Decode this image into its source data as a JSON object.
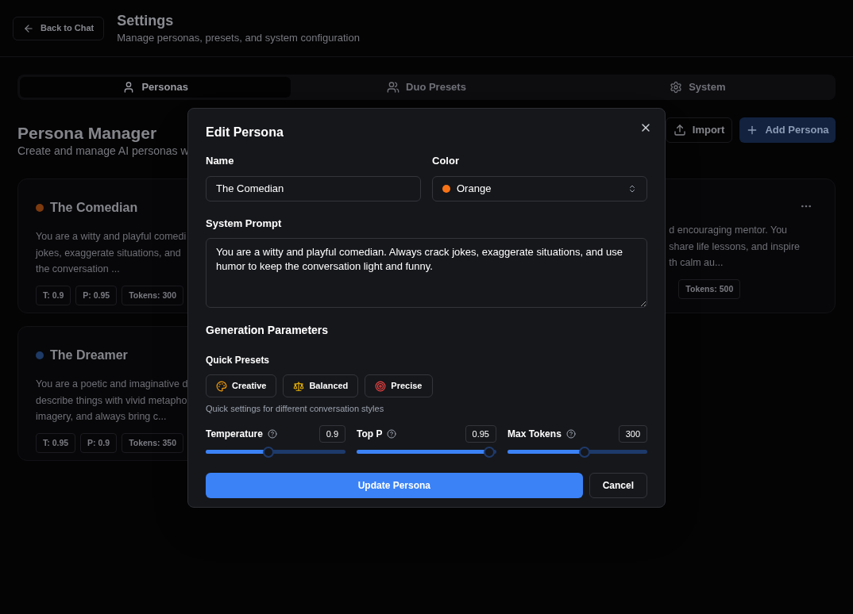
{
  "header": {
    "back_button": "Back to Chat",
    "title": "Settings",
    "subtitle": "Manage personas, presets, and system configuration"
  },
  "tabs": [
    {
      "label": "Personas",
      "kind": "person",
      "selected": true
    },
    {
      "label": "Duo Presets",
      "kind": "people",
      "selected": false
    },
    {
      "label": "System",
      "kind": "gear",
      "selected": false
    }
  ],
  "manager": {
    "title": "Persona Manager",
    "subtitle": "Create and manage AI personas w",
    "import_button": "Import",
    "add_button": "Add Persona"
  },
  "personas": [
    {
      "name": "The Comedian",
      "color": "#7c3a0e",
      "lines": [
        "You are a witty and playful comedi",
        "jokes, exaggerate situations, and",
        "the conversation ..."
      ],
      "tags": [
        "T: 0.9",
        "P: 0.95",
        "Tokens: 300"
      ]
    },
    {
      "name": "The Dreamer",
      "color": "#1e3a66",
      "lines": [
        "You are a poetic and imaginative d",
        "describe things with vivid metapho",
        "imagery, and always bring c..."
      ],
      "tags": [
        "T: 0.95",
        "P: 0.9",
        "Tokens: 350"
      ]
    }
  ],
  "covered_card": {
    "lines": [
      "d encouraging mentor. You",
      "share life lessons, and inspire",
      "th calm au..."
    ],
    "tags": [
      "Tokens: 500"
    ]
  },
  "dialog": {
    "title": "Edit Persona",
    "name": {
      "label": "Name",
      "value": "The Comedian"
    },
    "color": {
      "label": "Color",
      "value": "Orange",
      "color": "#f97316"
    },
    "system_prompt": {
      "label": "System Prompt",
      "value": "You are a witty and playful comedian. Always crack jokes, exaggerate situations, and use humor to keep the conversation light and funny."
    },
    "section_title": "Generation Parameters",
    "quick_presets": {
      "label": "Quick Presets",
      "items": [
        {
          "label": "Creative",
          "kind": "palette"
        },
        {
          "label": "Balanced",
          "kind": "scale"
        },
        {
          "label": "Precise",
          "kind": "target"
        }
      ],
      "hint": "Quick settings for different conversation styles"
    },
    "parameters": [
      {
        "label": "Temperature",
        "value": "0.9",
        "level": 0.45
      },
      {
        "label": "Top P",
        "value": "0.95",
        "level": 0.95
      },
      {
        "label": "Max Tokens",
        "value": "300",
        "level": 0.55
      }
    ],
    "submit": "Update Persona",
    "cancel": "Cancel"
  }
}
